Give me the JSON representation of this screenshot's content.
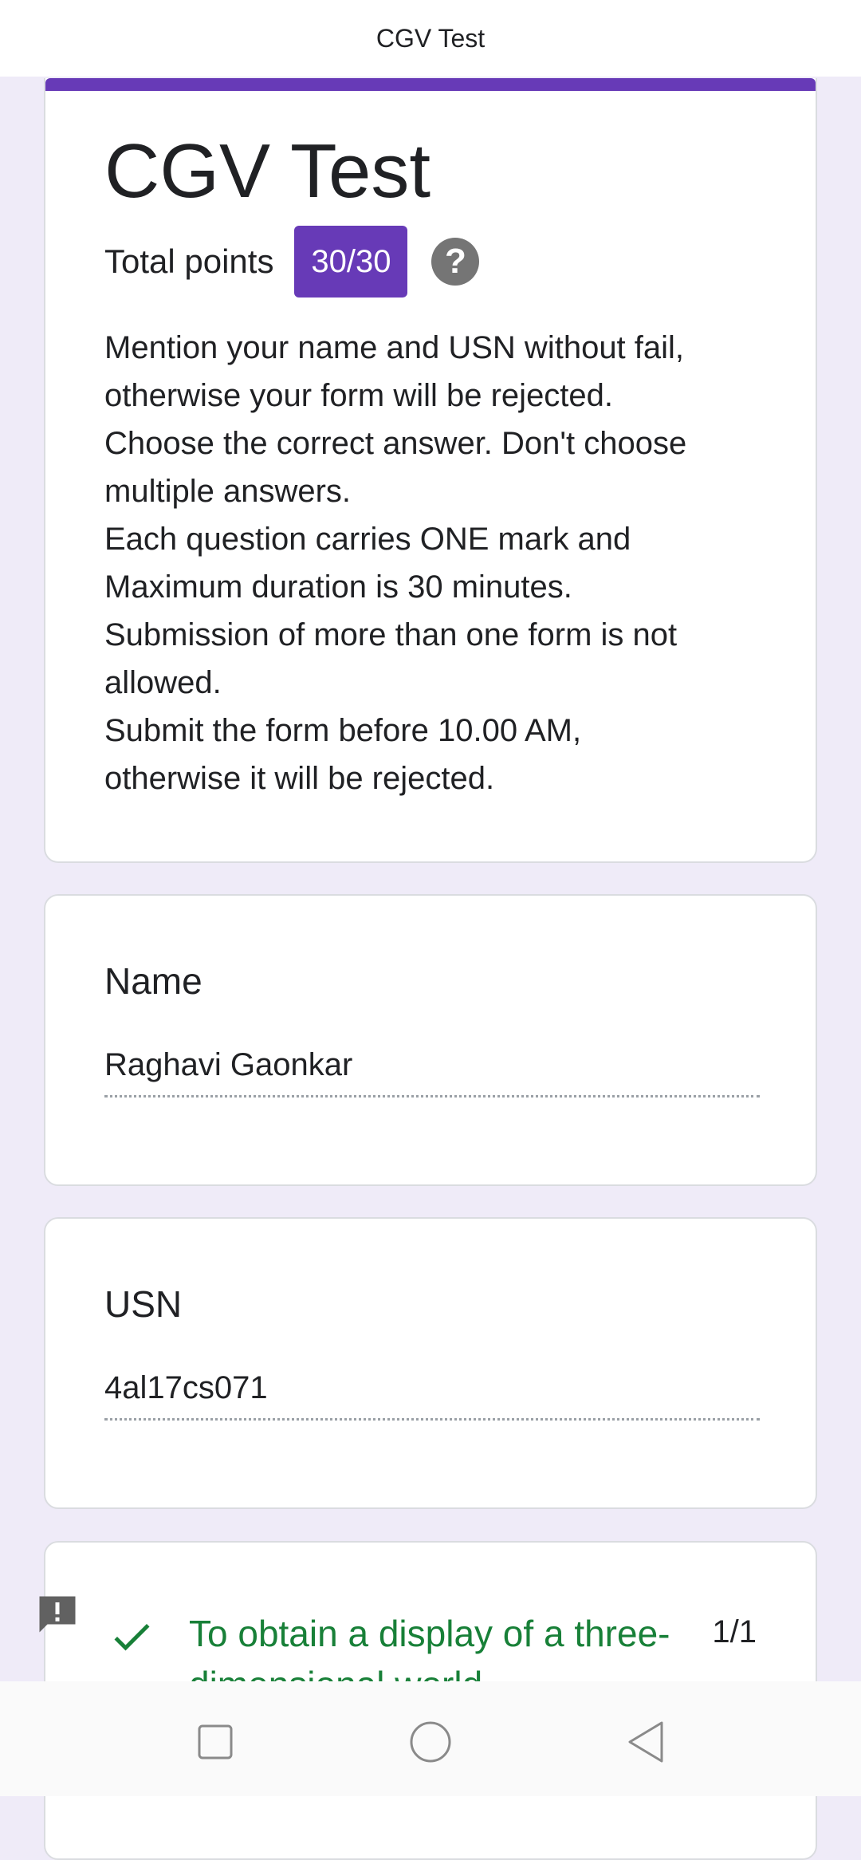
{
  "topbar": {
    "title": "CGV Test"
  },
  "header": {
    "title": "CGV Test",
    "points_label": "Total points",
    "points_value": "30/30",
    "help_glyph": "?",
    "accent_color": "#673ab7",
    "description_lines": [
      "Mention your name and USN without fail,",
      "otherwise your form will be rejected.",
      "Choose the correct answer. Don't choose",
      "multiple answers.",
      "Each question carries ONE mark and",
      "Maximum duration is 30 minutes.",
      "Submission of more than one form is not",
      "allowed.",
      "Submit the form before 10.00 AM,",
      "otherwise it will be rejected."
    ]
  },
  "questions": [
    {
      "title": "Name",
      "answer": "Raghavi Gaonkar"
    },
    {
      "title": "USN",
      "answer": "4al17cs071"
    }
  ],
  "quiz_item": {
    "question": "To obtain a display of a three-dimensional world",
    "score": "1/1",
    "status": "correct",
    "correct_color": "#188038",
    "icon": "check-icon"
  },
  "feedback": {
    "icon": "report-feedback-icon"
  },
  "navbar": {
    "recents_icon": "recents-icon",
    "home_icon": "home-icon",
    "back_icon": "back-icon"
  }
}
